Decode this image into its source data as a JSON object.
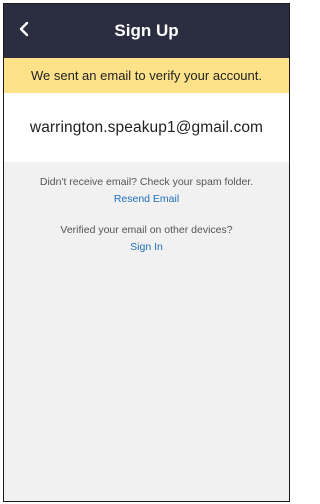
{
  "header": {
    "title": "Sign Up",
    "back_icon": "chevron-left-icon"
  },
  "banner": {
    "text": "We sent an email to verify your account."
  },
  "email": {
    "value": "warrington.speakup1@gmail.com"
  },
  "resend": {
    "hint": "Didn't receive email? Check your spam folder.",
    "link": "Resend Email"
  },
  "signin": {
    "hint": "Verified your email on other devices?",
    "link": "Sign In"
  },
  "colors": {
    "header_bg": "#2b2d40",
    "banner_bg": "#fde28a",
    "link": "#1e6fb8",
    "page_bg": "#f1f1f2"
  }
}
